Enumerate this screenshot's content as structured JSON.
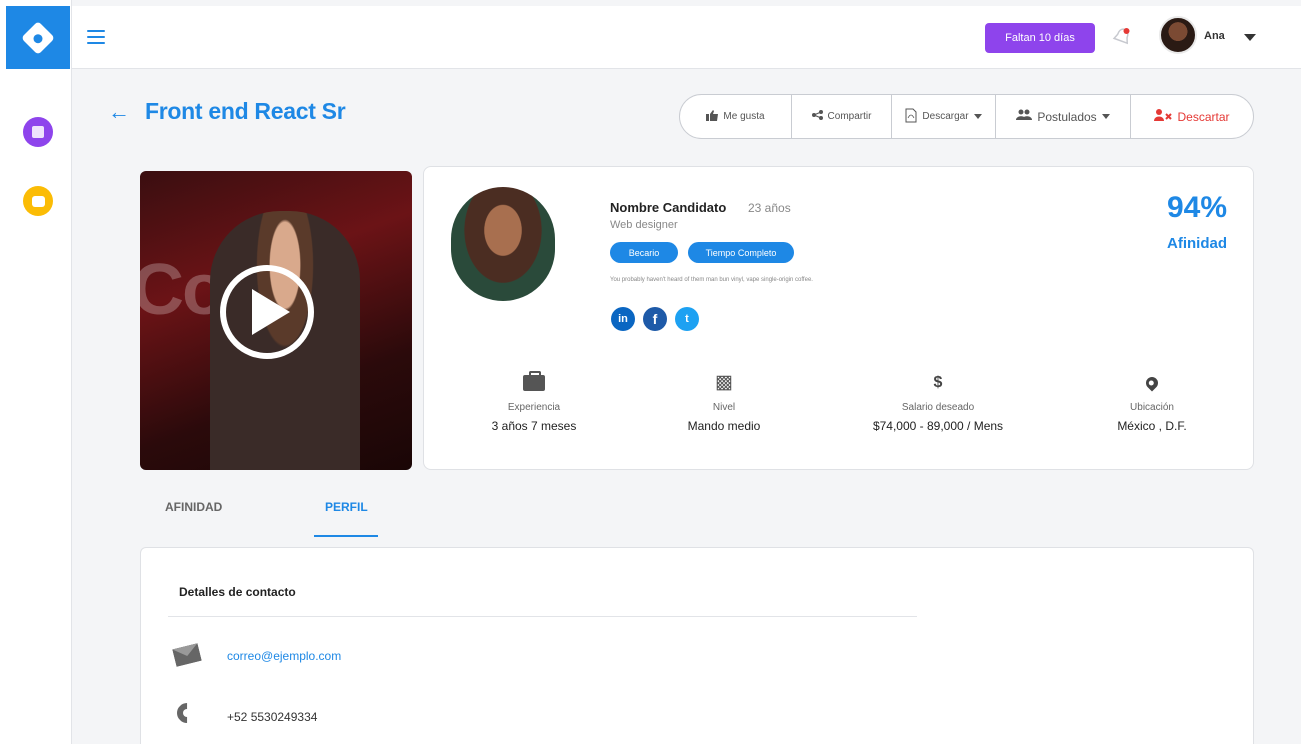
{
  "header": {
    "trial_label": "Faltan 10 días",
    "user_name": "Ana"
  },
  "job": {
    "title": "Front end React Sr"
  },
  "actions": {
    "like": "Me gusta",
    "share": "Compartir",
    "download": "Descargar",
    "applicants": "Postulados",
    "discard": "Descartar"
  },
  "video": {
    "stage_text": "Coa"
  },
  "candidate": {
    "name": "Nombre Candidato",
    "age": "23 años",
    "role": "Web designer",
    "tags": [
      "Becario",
      "Tiempo Completo"
    ],
    "bio": "You probably haven't heard of them man bun vinyl, vape single-origin coffee.",
    "social": [
      "in",
      "f",
      "t"
    ],
    "match_percent": "94%",
    "match_label": "Afinidad"
  },
  "stats": [
    {
      "icon": "briefcase-icon",
      "label": "Experiencia",
      "value": "3 años 7 meses"
    },
    {
      "icon": "cubes-icon",
      "label": "Nivel",
      "value": "Mando medio"
    },
    {
      "icon": "dollar-icon",
      "label": "Salario deseado",
      "value": "$74,000 - 89,000 / Mens"
    },
    {
      "icon": "location-pin-icon",
      "label": "Ubicación",
      "value": "México , D.F."
    }
  ],
  "tabs": {
    "affinity": "AFINIDAD",
    "profile": "PERFIL"
  },
  "contact": {
    "title": "Detalles de contacto",
    "email": "correo@ejemplo.com",
    "phone": "+52 5530249334"
  },
  "colors": {
    "brand_blue": "#1e88e5",
    "purple": "#8e44ec",
    "yellow": "#fbbc05",
    "danger": "#e53935"
  }
}
